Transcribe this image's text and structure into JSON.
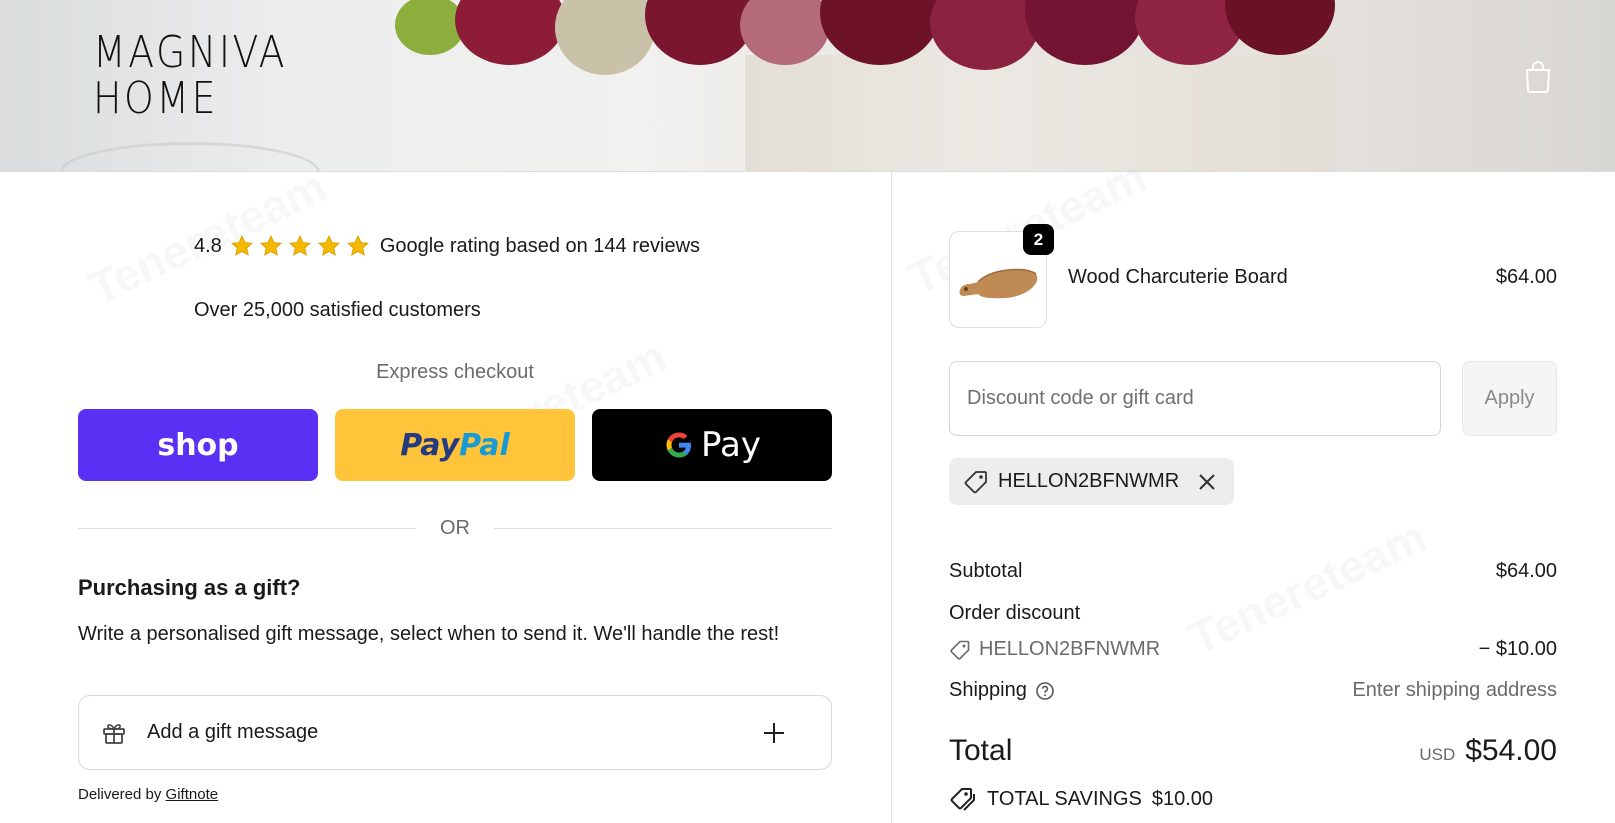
{
  "header": {
    "logo_line1": "MAGNIVA",
    "logo_line2": "HOME",
    "cart_icon": "shopping-bag-icon"
  },
  "trust": {
    "rating_score": "4.8",
    "star_count": 5,
    "rating_text": "Google rating based on 144 reviews",
    "customers_text": "Over 25,000 satisfied customers"
  },
  "express": {
    "title": "Express checkout",
    "shop_label": "shop",
    "paypal_label_a": "Pay",
    "paypal_label_b": "Pal",
    "gpay_label": "Pay"
  },
  "divider": {
    "or_text": "OR"
  },
  "gift": {
    "title": "Purchasing as a gift?",
    "description": "Write a personalised gift message, select when to send it. We'll handle the rest!",
    "add_label": "Add a gift message",
    "delivered_prefix": "Delivered by ",
    "delivered_link": "Giftnote"
  },
  "order": {
    "product": {
      "name": "Wood Charcuterie Board",
      "price": "$64.00",
      "quantity": "2"
    },
    "discount": {
      "placeholder": "Discount code or gift card",
      "apply_label": "Apply",
      "applied_code": "HELLON2BFNWMR"
    },
    "summary": {
      "subtotal_label": "Subtotal",
      "subtotal_value": "$64.00",
      "order_discount_label": "Order discount",
      "discount_code": "HELLON2BFNWMR",
      "discount_value": "− $10.00",
      "shipping_label": "Shipping",
      "shipping_value": "Enter shipping address",
      "total_label": "Total",
      "currency": "USD",
      "total_value": "$54.00",
      "savings_label": "TOTAL SAVINGS",
      "savings_value": "$10.00"
    }
  },
  "colors": {
    "shop_purple": "#5a31f4",
    "paypal_yellow": "#ffc439",
    "gpay_black": "#000000",
    "text": "#1a1a1a",
    "muted": "#6b6b6b"
  }
}
